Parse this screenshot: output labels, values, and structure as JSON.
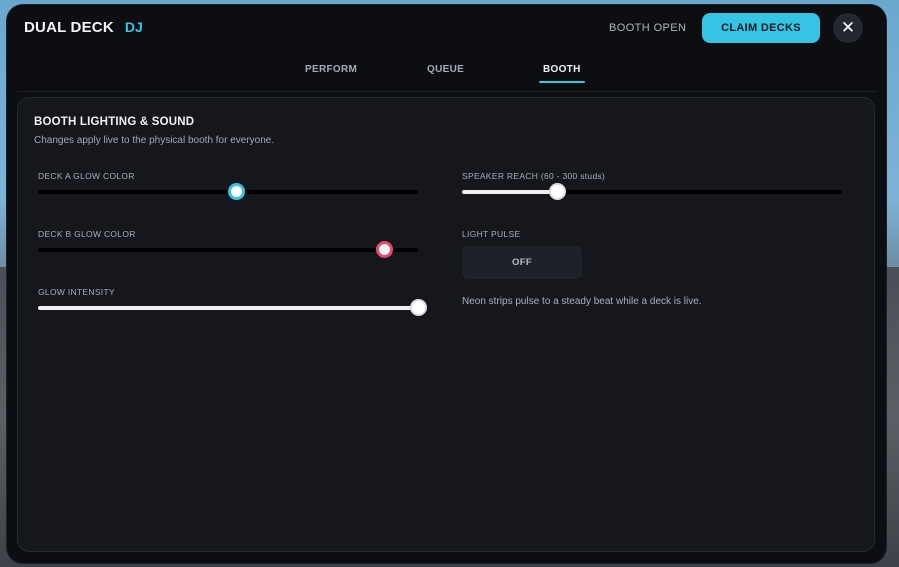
{
  "header": {
    "title": "DUAL DECK",
    "title_accent": "DJ",
    "status": "BOOTH OPEN",
    "claim_label": "CLAIM DECKS",
    "close_glyph": "✕"
  },
  "tabs": [
    {
      "label": "PERFORM",
      "active": false
    },
    {
      "label": "QUEUE",
      "active": false
    },
    {
      "label": "BOOTH",
      "active": true
    }
  ],
  "section": {
    "title": "BOOTH LIGHTING & SOUND",
    "subtitle": "Changes apply live to the physical booth for everyone."
  },
  "sliders": {
    "deck_a": {
      "label": "DECK A GLOW COLOR",
      "value": 0.52,
      "knob_color": "#35c4e4"
    },
    "deck_b": {
      "label": "DECK B GLOW COLOR",
      "value": 0.91,
      "knob_color": "#e8466f"
    },
    "glow_intensity": {
      "label": "GLOW INTENSITY",
      "value": 1.0
    },
    "speaker_reach": {
      "label": "SPEAKER REACH (60 - 300 studs)",
      "value": 0.25
    }
  },
  "light_pulse": {
    "label": "LIGHT PULSE",
    "state": "OFF",
    "note": "Neon strips pulse to a steady beat while a deck is live."
  },
  "colors": {
    "accent": "#36c6e6",
    "panel_bg": "#0d0e12",
    "card_bg": "#15171d"
  },
  "icons": {
    "close": "close-icon"
  }
}
